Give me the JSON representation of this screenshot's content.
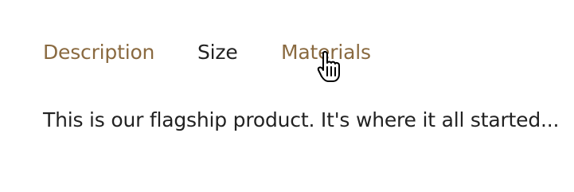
{
  "colors": {
    "tab_link": "#8a6a40",
    "tab_active": "#222222",
    "body_text": "#222222",
    "background": "#ffffff"
  },
  "tabs": [
    {
      "label": "Description"
    },
    {
      "label": "Size"
    },
    {
      "label": "Materials"
    }
  ],
  "panel": {
    "text": "This is our flagship product. It's where it all started..."
  },
  "cursor": {
    "icon": "hand-pointer-cursor"
  }
}
